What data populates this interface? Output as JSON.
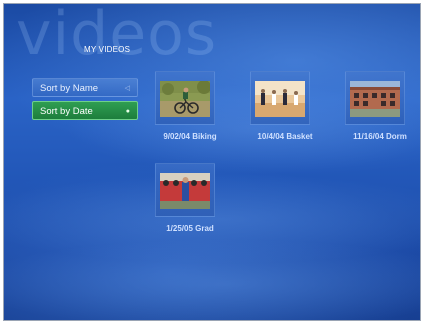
{
  "watermark": "videos",
  "page_title": "MY VIDEOS",
  "sort_menu": {
    "items": [
      {
        "label": "Sort by Name",
        "marker": "◁"
      },
      {
        "label": "Sort by Date",
        "marker": "●"
      }
    ],
    "selected": "Sort by Date"
  },
  "videos": [
    {
      "caption": "9/02/04 Biking",
      "thumb": "biking-photo"
    },
    {
      "caption": "10/4/04 Basket",
      "thumb": "basketball-photo"
    },
    {
      "caption": "11/16/04 Dorm",
      "thumb": "dorm-building-photo"
    },
    {
      "caption": "1/25/05 Grad",
      "thumb": "graduation-photo"
    }
  ],
  "colors": {
    "background": "#2257b8",
    "selected_item": "#1d7e3c",
    "caption_text": "#cfe0ff"
  }
}
